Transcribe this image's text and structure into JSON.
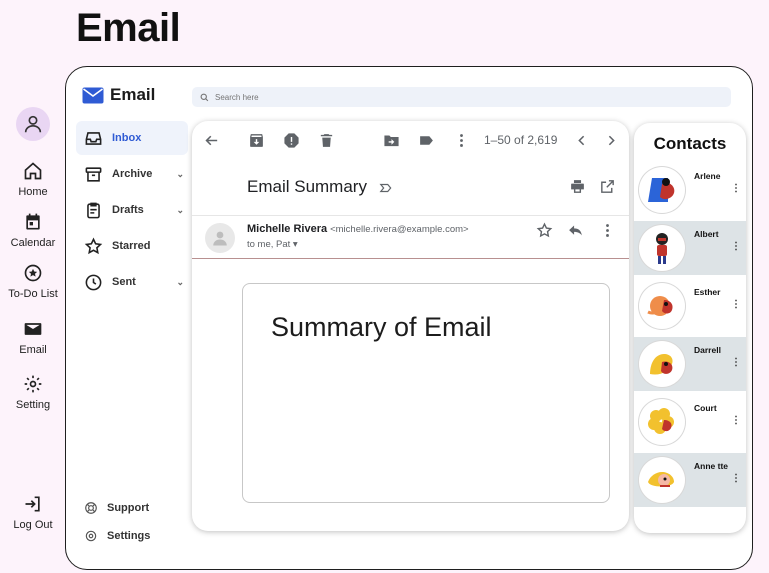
{
  "page": {
    "title": "Email"
  },
  "nav": {
    "items": [
      {
        "label": "Home",
        "icon": "home-icon"
      },
      {
        "label": "Calendar",
        "icon": "calendar-icon"
      },
      {
        "label": "To-Do List",
        "icon": "star-circle-icon"
      },
      {
        "label": "Email",
        "icon": "mail-icon"
      },
      {
        "label": "Setting",
        "icon": "gear-icon"
      }
    ],
    "logout": "Log Out"
  },
  "app": {
    "brand": "Email",
    "accent": "#2f5bd4",
    "search_placeholder": "Search here",
    "folders": [
      {
        "label": "Inbox",
        "icon": "inbox-icon",
        "active": true
      },
      {
        "label": "Archive",
        "icon": "archive-icon"
      },
      {
        "label": "Drafts",
        "icon": "clipboard-icon"
      },
      {
        "label": "Starred",
        "icon": "star-icon"
      },
      {
        "label": "Sent",
        "icon": "clock-icon"
      }
    ],
    "footer": [
      {
        "label": "Support",
        "icon": "lifebuoy-icon"
      },
      {
        "label": "Settings",
        "icon": "gear-icon"
      }
    ]
  },
  "message": {
    "pagination": "1–50 of 2,619",
    "subject": "Email Summary",
    "sender_name": "Michelle Rivera",
    "sender_email": "<michelle.rivera@example.com>",
    "recipients": "to me, Pat ▾",
    "body_title": "Summary of Email"
  },
  "contacts": {
    "title": "Contacts",
    "items": [
      {
        "name": "Arlene",
        "highlight": false
      },
      {
        "name": "Albert",
        "highlight": true
      },
      {
        "name": "Esther",
        "highlight": false
      },
      {
        "name": "Darrell",
        "highlight": true
      },
      {
        "name": "Court",
        "highlight": false
      },
      {
        "name": "Anne tte",
        "highlight": true
      }
    ]
  }
}
